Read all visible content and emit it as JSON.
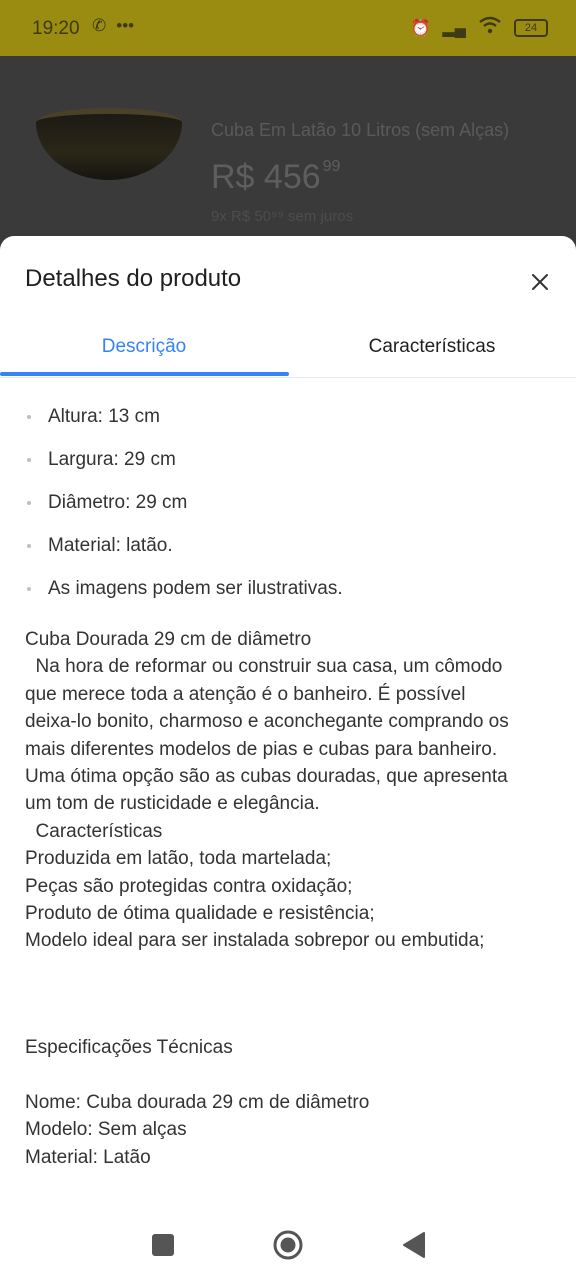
{
  "status_bar": {
    "time": "19:20",
    "battery": "24"
  },
  "background_product": {
    "title": "Cuba Em Latão 10 Litros (sem Alças)",
    "price_main": "R$ 456",
    "price_cents": "99",
    "installments": "9x R$ 50⁹⁹ sem juros"
  },
  "sheet": {
    "title": "Detalhes do produto",
    "tabs": [
      "Descrição",
      "Características"
    ],
    "active_tab": "Descrição",
    "bullets": [
      "Altura: 13 cm",
      "Largura: 29 cm",
      "Diâmetro: 29 cm",
      "Material: latão.",
      "As imagens podem ser ilustrativas."
    ],
    "description_lines": [
      "Cuba Dourada 29 cm de diâmetro",
      "  Na hora de reformar ou construir sua casa, um cômodo",
      "que merece toda a atenção é o banheiro. É possível",
      "deixa-lo bonito, charmoso e aconchegante comprando os",
      "mais diferentes modelos de pias e cubas para banheiro.",
      "Uma ótima opção são as cubas douradas, que apresenta",
      "um tom de rusticidade e elegância.",
      "  Características",
      "Produzida em latão, toda martelada;",
      "Peças são protegidas contra oxidação;",
      "Produto de ótima qualidade e resistência;",
      "Modelo ideal para ser instalada sobrepor ou embutida;"
    ],
    "specs_lines": [
      "Especificações Técnicas",
      "",
      "Nome: Cuba dourada 29 cm de diâmetro",
      "Modelo: Sem alças",
      "Material: Latão"
    ]
  },
  "icons": {
    "close": "close-icon",
    "nav_recents": "square-icon",
    "nav_home": "circle-icon",
    "nav_back": "triangle-back-icon"
  },
  "colors": {
    "accent": "#3483fa",
    "status_bar": "#9a8c10"
  }
}
